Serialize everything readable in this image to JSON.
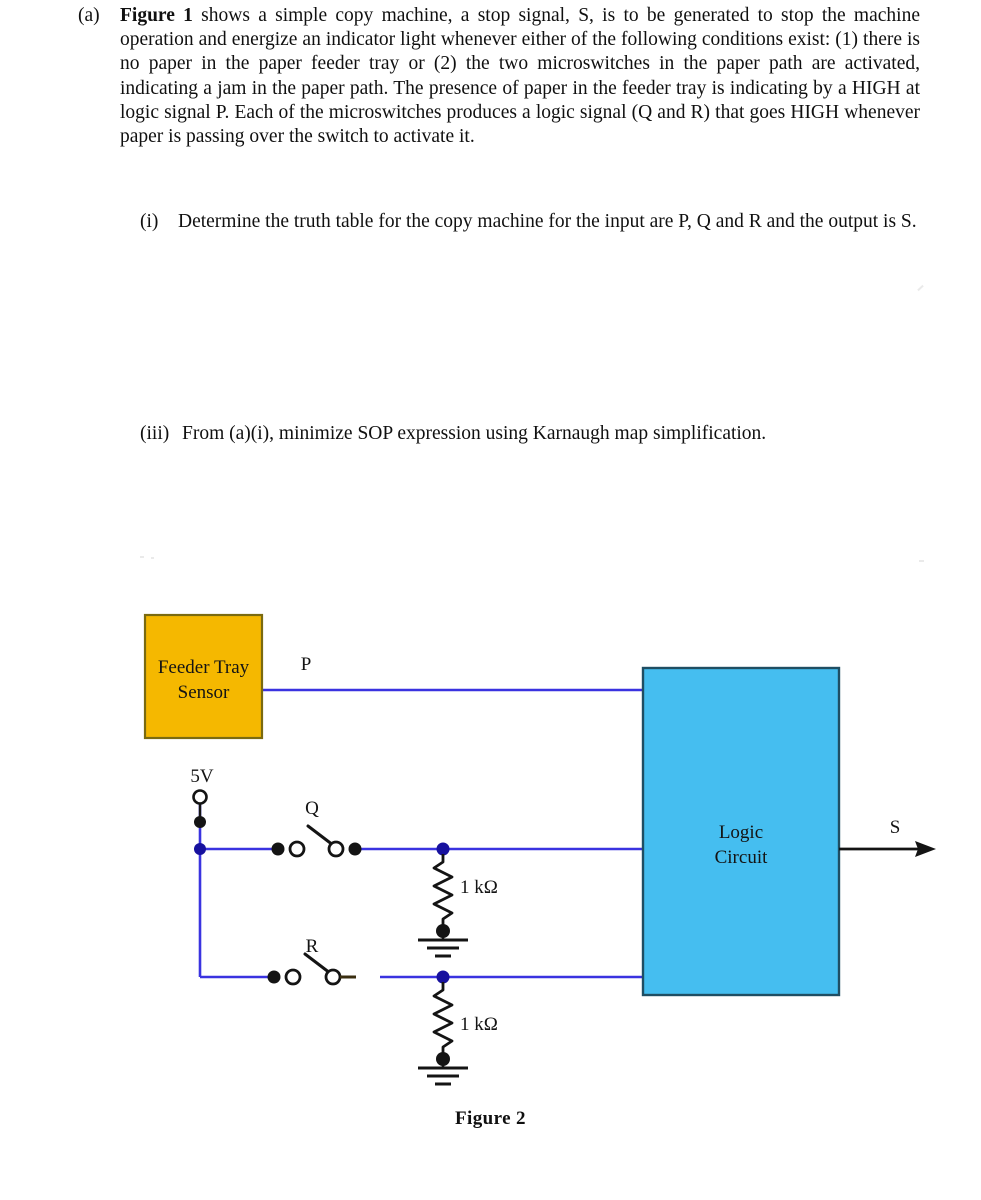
{
  "question": {
    "marker": "(a)",
    "figure_ref": "Figure 1",
    "text": " shows a simple copy machine, a stop signal, S, is to be generated to stop the machine operation and energize an indicator light whenever either of the following conditions exist: (1) there is no paper in the paper feeder tray or (2) the two microswitches in the paper path are activated, indicating a jam in the paper path. The presence of paper in the feeder tray is indicating by a HIGH at logic signal P. Each of the microswitches produces a logic signal (Q and R) that goes HIGH whenever paper is passing over the switch to activate it."
  },
  "sub_questions": [
    {
      "marker": "(i)",
      "text": "Determine the truth table for the copy machine for the input are P, Q and R and the output is S."
    },
    {
      "marker": "(iii)",
      "text": "From (a)(i), minimize SOP expression using Karnaugh map simplification."
    }
  ],
  "figure": {
    "caption": "Figure 2",
    "sensor_box": {
      "line1": "Feeder Tray",
      "line2": "Sensor",
      "fill": "#F5B800",
      "stroke": "#7A6A10"
    },
    "logic_box": {
      "line1": "Logic",
      "line2": "Circuit",
      "fill": "#45BEF0",
      "stroke": "#1F4E63"
    },
    "labels": {
      "p": "P",
      "q": "Q",
      "r": "R",
      "s": "S",
      "supply": "5V",
      "resistor_top": "1 kΩ",
      "resistor_bottom": "1 kΩ"
    },
    "wire_color": "#3A33E0",
    "ink_color": "#141414"
  }
}
